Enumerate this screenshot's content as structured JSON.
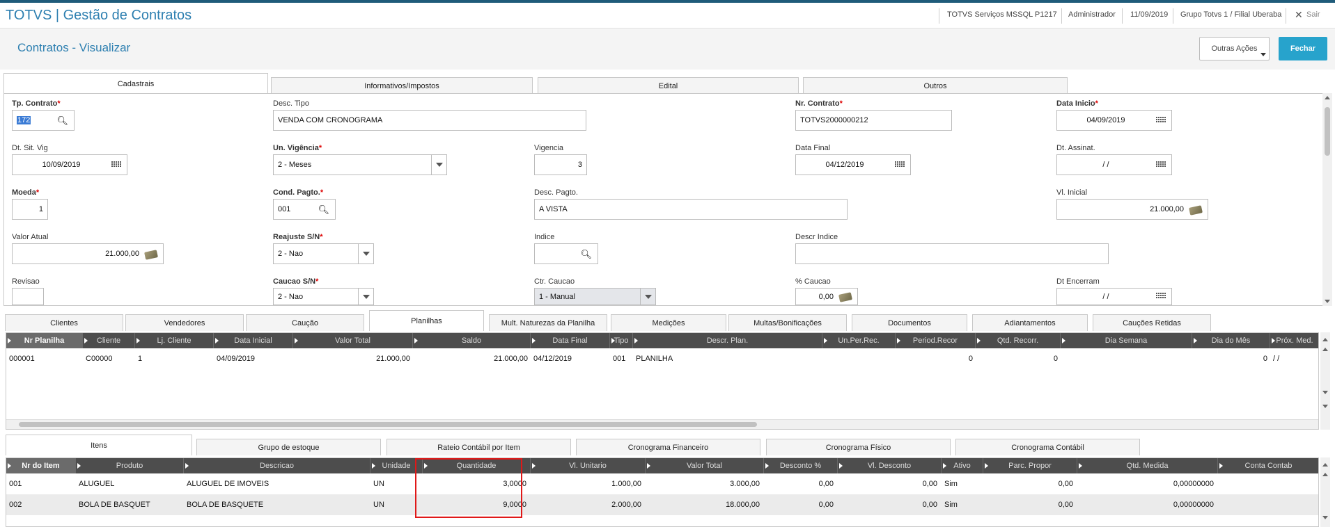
{
  "app": {
    "title": "TOTVS | Gestão de Contratos"
  },
  "topbar": {
    "environment": "TOTVS Serviços MSSQL P1217",
    "user": "Administrador",
    "date": "11/09/2019",
    "branch": "Grupo Totvs 1 / Filial Uberaba",
    "exit_label": "Sair"
  },
  "page": {
    "title": "Contratos - Visualizar"
  },
  "actions": {
    "outras": "Outras Ações",
    "fechar": "Fechar"
  },
  "main_tabs": [
    "Cadastrais",
    "Informativos/Impostos",
    "Edital",
    "Outros"
  ],
  "form": {
    "tp_contrato": {
      "label": "Tp. Contrato",
      "value": "172"
    },
    "desc_tipo": {
      "label": "Desc. Tipo",
      "value": "VENDA COM CRONOGRAMA"
    },
    "nr_contrato": {
      "label": "Nr. Contrato",
      "value": "TOTVS2000000212"
    },
    "data_inicio": {
      "label": "Data Inicio",
      "value": "04/09/2019"
    },
    "dt_sit_vig": {
      "label": "Dt. Sit. Vig",
      "value": "10/09/2019"
    },
    "un_vigencia": {
      "label": "Un. Vigência",
      "value": "2 - Meses"
    },
    "vigencia": {
      "label": "Vigencia",
      "value": "3"
    },
    "data_final": {
      "label": "Data Final",
      "value": "04/12/2019"
    },
    "dt_assinat": {
      "label": "Dt. Assinat.",
      "value": "/ /"
    },
    "moeda": {
      "label": "Moeda",
      "value": "1"
    },
    "cond_pagto": {
      "label": "Cond. Pagto.",
      "value": "001"
    },
    "desc_pagto": {
      "label": "Desc. Pagto.",
      "value": "A VISTA"
    },
    "vl_inicial": {
      "label": "Vl. Inicial",
      "value": "21.000,00"
    },
    "valor_atual": {
      "label": "Valor Atual",
      "value": "21.000,00"
    },
    "reajuste": {
      "label": "Reajuste S/N",
      "value": "2 - Nao"
    },
    "indice": {
      "label": "Indice",
      "value": ""
    },
    "descr_indice": {
      "label": "Descr Indice",
      "value": ""
    },
    "revisao": {
      "label": "Revisao",
      "value": ""
    },
    "caucao": {
      "label": "Caucao S/N",
      "value": "2 - Nao"
    },
    "ctr_caucao": {
      "label": "Ctr. Caucao",
      "value": "1 - Manual"
    },
    "pct_caucao": {
      "label": "% Caucao",
      "value": "0,00"
    },
    "dt_encerram": {
      "label": "Dt Encerram",
      "value": "/ /"
    }
  },
  "sub_tabs": [
    "Clientes",
    "Vendedores",
    "Caução",
    "Planilhas",
    "Mult. Naturezas da Planilha",
    "Medições",
    "Multas/Bonificações",
    "Documentos",
    "Adiantamentos",
    "Cauções Retidas"
  ],
  "planilhas": {
    "columns": [
      "Nr Planilha",
      "Cliente",
      "Lj. Cliente",
      "Data Inicial",
      "Valor Total",
      "Saldo",
      "Data Final",
      "Tipo",
      "Descr. Plan.",
      "Un.Per.Rec.",
      "Period.Recor",
      "Qtd. Recorr.",
      "Dia Semana",
      "Dia do Mês",
      "Próx. Med."
    ],
    "rows": [
      [
        "000001",
        "C00000",
        "1",
        "04/09/2019",
        "21.000,00",
        "21.000,00",
        "04/12/2019",
        "001",
        "PLANILHA",
        "",
        "0",
        "0",
        "",
        "0",
        "/ /"
      ]
    ]
  },
  "item_tabs": [
    "Itens",
    "Grupo de estoque",
    "Rateio Contábil por Item",
    "Cronograma Financeiro",
    "Cronograma Físico",
    "Cronograma Contábil"
  ],
  "itens": {
    "columns": [
      "Nr do Item",
      "Produto",
      "Descricao",
      "Unidade",
      "Quantidade",
      "Vl. Unitario",
      "Valor Total",
      "Desconto %",
      "Vl. Desconto",
      "Ativo",
      "Parc. Propor",
      "Qtd. Medida",
      "Conta Contab"
    ],
    "rows": [
      [
        "001",
        "ALUGUEL",
        "ALUGUEL DE IMOVEIS",
        "UN",
        "3,0000",
        "1.000,00",
        "3.000,00",
        "0,00",
        "0,00",
        "Sim",
        "0,00",
        "0,00000000",
        ""
      ],
      [
        "002",
        "BOLA DE BASQUET",
        "BOLA DE BASQUETE",
        "UN",
        "9,0000",
        "2.000,00",
        "18.000,00",
        "0,00",
        "0,00",
        "Sim",
        "0,00",
        "0,00000000",
        ""
      ]
    ]
  },
  "colors": {
    "accent": "#2d7fb0",
    "button": "#27a3cc",
    "grid_header": "#4d4d4d",
    "highlight": "#e01818"
  }
}
